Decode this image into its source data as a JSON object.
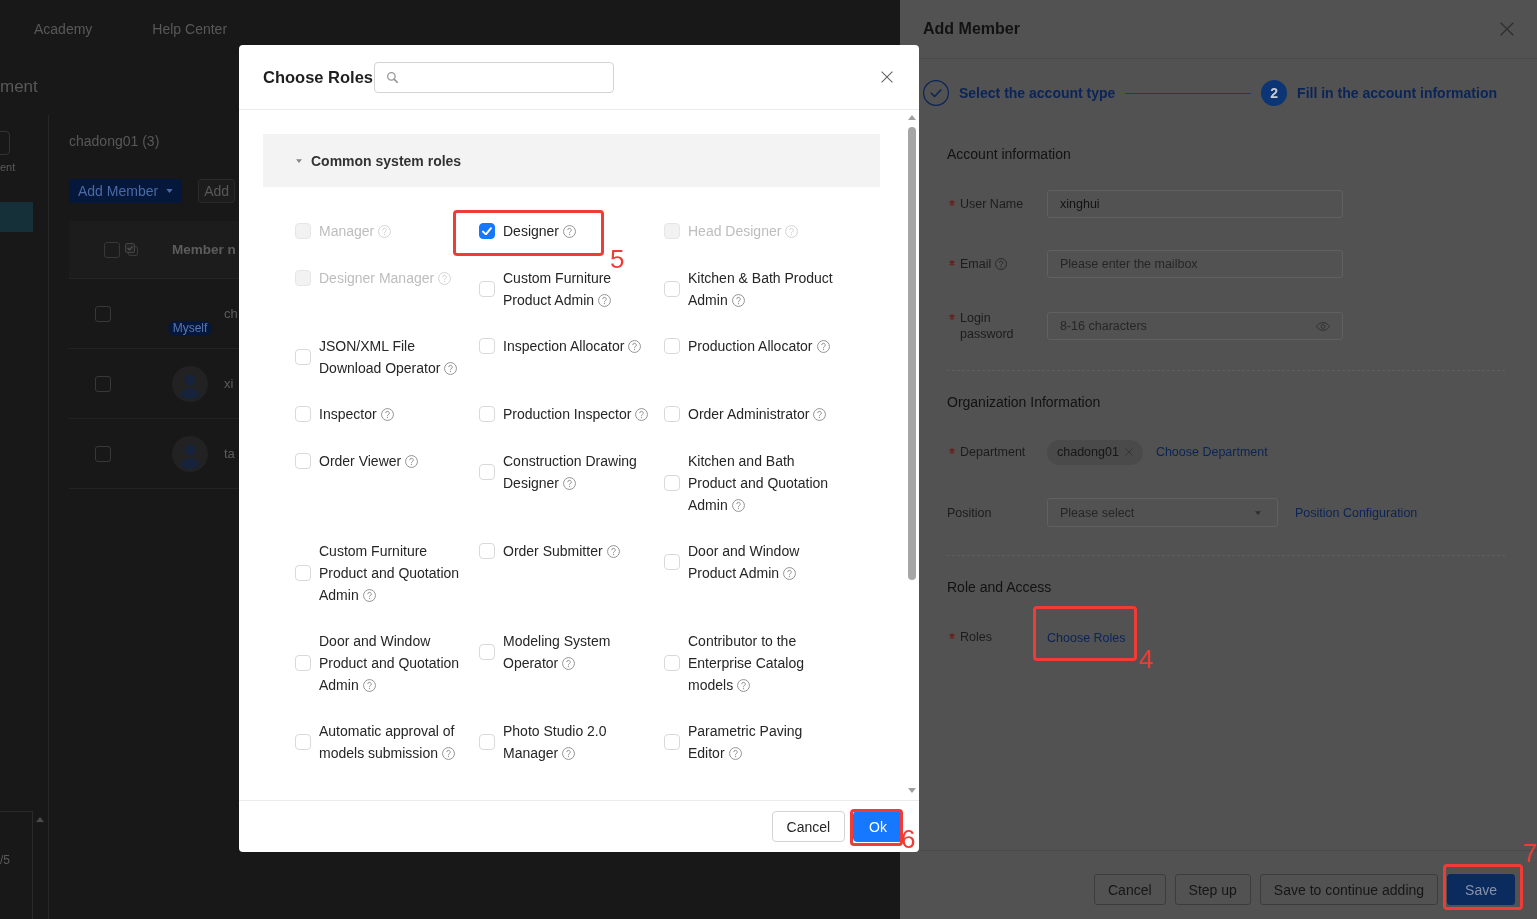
{
  "background_page": {
    "nav_links": [
      "Academy",
      "Help Center"
    ],
    "page_title": "ment",
    "sidebar": {
      "caption": "ent",
      "items": [
        {
          "selected": true
        }
      ],
      "pager": "/5"
    },
    "main": {
      "title": "chadong01 (3)",
      "buttons": [
        {
          "label": "Add Member",
          "kind": "primary-dropdown"
        },
        {
          "label": "Add",
          "kind": "default"
        }
      ],
      "table": {
        "select_all": {
          "checked": false
        },
        "columns": [
          "Member n"
        ],
        "rows": [
          {
            "name": "ch",
            "badge": "Myself",
            "avatar": false,
            "checked": false
          },
          {
            "name": "xi",
            "avatar": true,
            "checked": false
          },
          {
            "name": "ta",
            "avatar": true,
            "checked": false
          }
        ]
      }
    }
  },
  "drawer": {
    "title": "Add Member",
    "steps": [
      {
        "label": "Select the account type",
        "done": true
      },
      {
        "label": "Fill in the account information",
        "number": "2",
        "done": false
      }
    ],
    "sections": [
      {
        "title": "Account information",
        "fields": [
          {
            "kind": "input",
            "label": "User Name",
            "required": true,
            "value": "xinghui"
          },
          {
            "kind": "input",
            "label": "Email",
            "required": true,
            "help": true,
            "placeholder": "Please enter the mailbox"
          },
          {
            "kind": "password",
            "label": "Login password",
            "required": true,
            "placeholder": "8-16 characters"
          }
        ]
      },
      {
        "title": "Organization Information",
        "fields": [
          {
            "kind": "tags",
            "label": "Department",
            "required": true,
            "tags": [
              "chadong01"
            ],
            "link": "Choose Department"
          },
          {
            "kind": "select",
            "label": "Position",
            "required": false,
            "placeholder": "Please select",
            "link": "Position Configuration"
          }
        ]
      },
      {
        "title": "Role and Access",
        "fields": [
          {
            "kind": "link",
            "label": "Roles",
            "required": true,
            "link": "Choose Roles",
            "callout": "4"
          }
        ]
      }
    ],
    "buttons": [
      {
        "label": "Cancel",
        "kind": "default"
      },
      {
        "label": "Step up",
        "kind": "default"
      },
      {
        "label": "Save to continue adding",
        "kind": "default"
      },
      {
        "label": "Save",
        "kind": "primary",
        "callout": "7"
      }
    ]
  },
  "modal": {
    "title": "Choose Roles",
    "groups": [
      {
        "title": "Common system roles",
        "expanded": true,
        "roles": [
          {
            "label": "Manager",
            "checked": false,
            "disabled": true
          },
          {
            "label": "Designer",
            "checked": true,
            "disabled": false,
            "callout": "5"
          },
          {
            "label": "Head Designer",
            "checked": false,
            "disabled": true
          },
          {
            "label": "Designer Manager",
            "checked": false,
            "disabled": true
          },
          {
            "label": "Custom Furniture Product Admin",
            "checked": false,
            "disabled": false
          },
          {
            "label": "Kitchen & Bath Product Admin",
            "checked": false,
            "disabled": false
          },
          {
            "label": "JSON/XML File Download Operator",
            "checked": false,
            "disabled": false
          },
          {
            "label": "Inspection Allocator",
            "checked": false,
            "disabled": false
          },
          {
            "label": "Production Allocator",
            "checked": false,
            "disabled": false
          },
          {
            "label": "Inspector",
            "checked": false,
            "disabled": false
          },
          {
            "label": "Production Inspector",
            "checked": false,
            "disabled": false
          },
          {
            "label": "Order Administrator",
            "checked": false,
            "disabled": false
          },
          {
            "label": "Order Viewer",
            "checked": false,
            "disabled": false
          },
          {
            "label": "Construction Drawing Designer",
            "checked": false,
            "disabled": false
          },
          {
            "label": "Kitchen and Bath Product and Quotation Admin",
            "checked": false,
            "disabled": false
          },
          {
            "label": "Custom Furniture Product and Quotation Admin",
            "checked": false,
            "disabled": false
          },
          {
            "label": "Order Submitter",
            "checked": false,
            "disabled": false
          },
          {
            "label": "Door and Window Product Admin",
            "checked": false,
            "disabled": false
          },
          {
            "label": "Door and Window Product and Quotation Admin",
            "checked": false,
            "disabled": false
          },
          {
            "label": "Modeling System Operator",
            "checked": false,
            "disabled": false
          },
          {
            "label": "Contributor to the Enterprise Catalog models",
            "checked": false,
            "disabled": false
          },
          {
            "label": "Automatic approval of models submission",
            "checked": false,
            "disabled": false
          },
          {
            "label": "Photo Studio 2.0 Manager",
            "checked": false,
            "disabled": false
          },
          {
            "label": "Parametric Paving Editor",
            "checked": false,
            "disabled": false
          }
        ]
      }
    ],
    "buttons": [
      {
        "label": "Cancel",
        "kind": "default"
      },
      {
        "label": "Ok",
        "kind": "primary",
        "callout": "6"
      }
    ]
  }
}
